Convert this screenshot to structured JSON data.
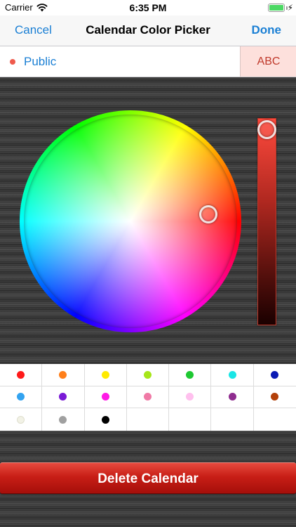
{
  "status_bar": {
    "carrier": "Carrier",
    "time": "6:35 PM",
    "battery_level": 1.0
  },
  "nav": {
    "cancel_label": "Cancel",
    "title": "Calendar Color Picker",
    "done_label": "Done"
  },
  "calendar": {
    "name": "Public",
    "preview_text": "ABC",
    "dot_color": "#ef5a4c",
    "preview_text_color": "#c0392b",
    "preview_bg_color": "#fde0dc"
  },
  "picker": {
    "selected_color": "#ef5a4c"
  },
  "swatches": [
    "#ff1a1a",
    "#ff7f1a",
    "#ffea00",
    "#a6e619",
    "#1ec832",
    "#1ae6e6",
    "#0a1ab4",
    "#33a3f0",
    "#7a1ad6",
    "#ff1ae6",
    "#f07aa6",
    "#ffc0ee",
    "#8f2d8f",
    "#b3400a",
    "#f2f2e6",
    "#a0a0a0",
    "#000000",
    null,
    null,
    null,
    null
  ],
  "delete_button": {
    "label": "Delete Calendar"
  },
  "colors": {
    "accent": "#1a7fd4",
    "danger": "#c81e16"
  }
}
